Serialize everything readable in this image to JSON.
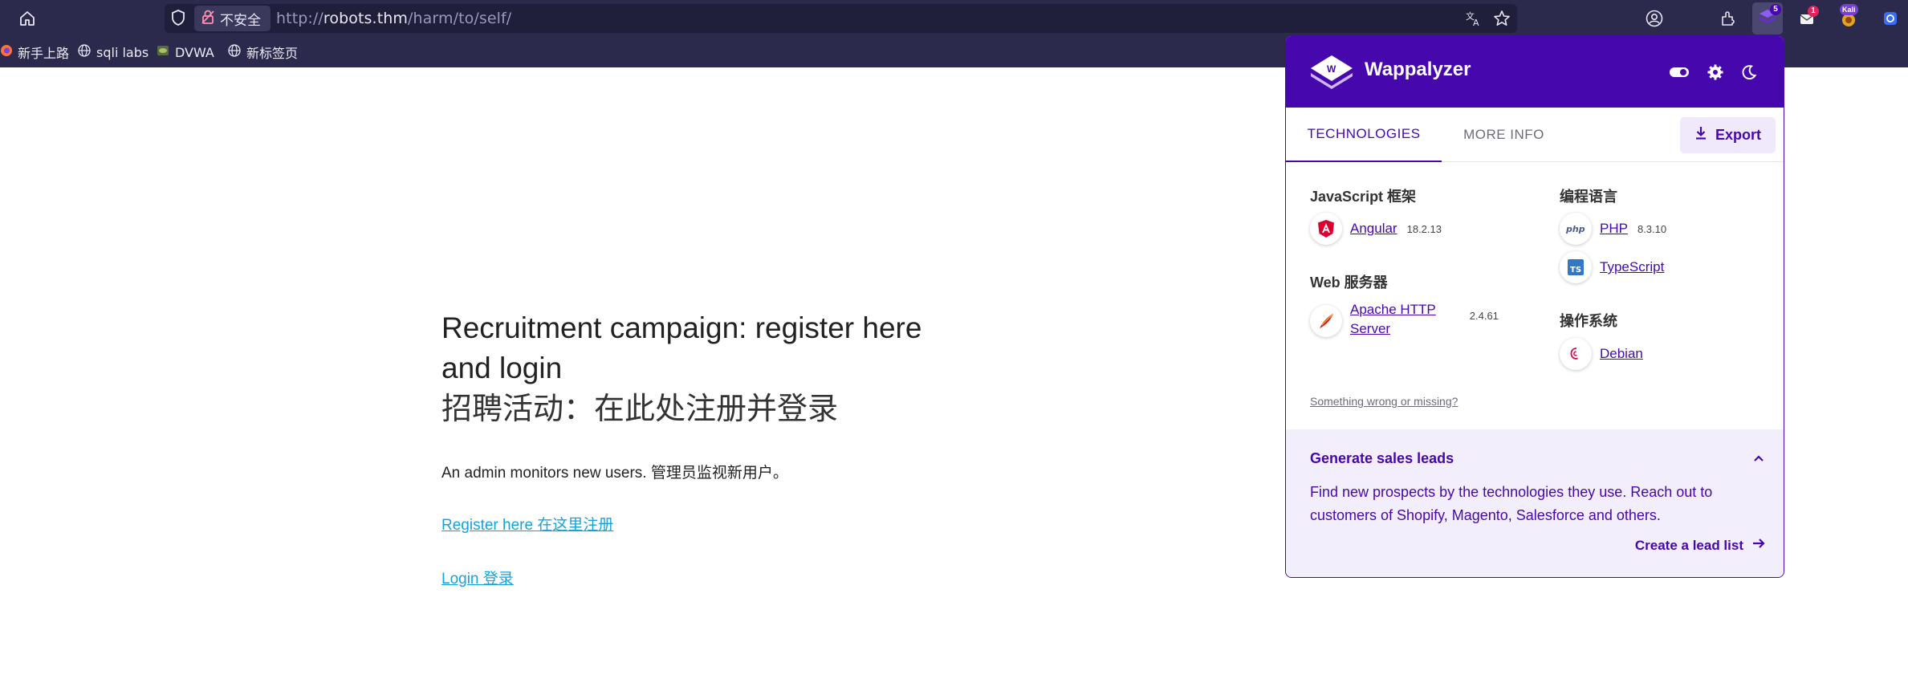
{
  "browser": {
    "security_label": "不安全",
    "url_scheme": "http://",
    "url_host": "robots.thm",
    "url_path": "/harm/to/self/",
    "icons": [
      "home-icon",
      "shield-icon",
      "lock-warning-icon",
      "translate-icon",
      "bookmark-star-icon",
      "account-icon",
      "extensions-icon",
      "wappalyzer-ext-icon",
      "mail-ext-icon",
      "kali-ext-icon",
      "tab-icon"
    ],
    "wappalyzer_badge": "5",
    "mail_badge": "1",
    "kali_badge": "Kali"
  },
  "bookmarks": [
    {
      "label": "新手上路",
      "icon": "firefox-icon"
    },
    {
      "label": "sqli labs",
      "icon": "globe-icon"
    },
    {
      "label": "DVWA",
      "icon": "dvwa-icon"
    },
    {
      "label": "新标签页",
      "icon": "globe-icon"
    }
  ],
  "page": {
    "heading_en": "Recruitment campaign: register here and login",
    "heading_zh": "招聘活动：在此处注册并登录",
    "note": "An admin monitors new users. 管理员监视新用户。",
    "register_link": "Register here 在这里注册",
    "login_link": "Login 登录",
    "link_color": "#17a2d8"
  },
  "wappalyzer": {
    "title": "Wappalyzer",
    "brand_color": "#4608ad",
    "tabs": [
      "TECHNOLOGIES",
      "MORE INFO"
    ],
    "export_label": "Export",
    "categories": {
      "js_frameworks": {
        "label": "JavaScript 框架",
        "items": [
          {
            "name": "Angular",
            "version": "18.2.13"
          }
        ]
      },
      "web_servers": {
        "label": "Web 服务器",
        "items": [
          {
            "name_line1": "Apache HTTP",
            "name_line2": "Server",
            "version": "2.4.61"
          }
        ]
      },
      "languages": {
        "label": "编程语言",
        "items": [
          {
            "name": "PHP",
            "version": "8.3.10"
          },
          {
            "name": "TypeScript",
            "version": ""
          }
        ]
      },
      "os": {
        "label": "操作系统",
        "items": [
          {
            "name": "Debian",
            "version": ""
          }
        ]
      }
    },
    "feedback_link": "Something wrong or missing?",
    "leads": {
      "title": "Generate sales leads",
      "text": "Find new prospects by the technologies they use. Reach out to customers of Shopify, Magento, Salesforce and others.",
      "cta": "Create a lead list"
    }
  }
}
